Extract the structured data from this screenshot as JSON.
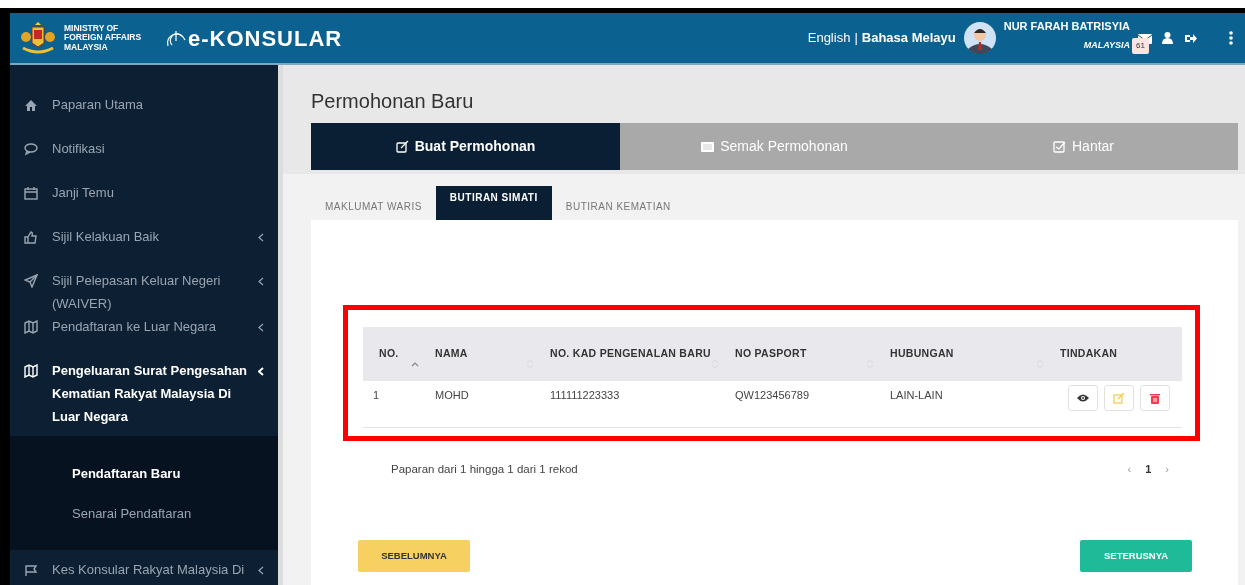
{
  "header": {
    "ministry": "MINISTRY OF FOREIGN AFFAIRS MALAYSIA",
    "app_name": "e-KONSULAR",
    "languages": [
      {
        "label": "English",
        "selected": false
      },
      {
        "label": "Bahasa Melayu",
        "selected": true
      }
    ],
    "separator": "|",
    "user_name": "NUR FARAH BATRISYIA",
    "user_country": "MALAYSIA",
    "mail_count": "61"
  },
  "sidebar": {
    "items": [
      {
        "label": "Paparan Utama",
        "has_submenu": false,
        "active": false
      },
      {
        "label": "Notifikasi",
        "has_submenu": false,
        "active": false
      },
      {
        "label": "Janji Temu",
        "has_submenu": false,
        "active": false
      },
      {
        "label": "Sijil Kelakuan Baik",
        "has_submenu": true,
        "active": false
      },
      {
        "label": "Sijil Pelepasan Keluar Negeri (WAIVER)",
        "has_submenu": true,
        "active": false
      },
      {
        "label": "Pendaftaran ke Luar Negara",
        "has_submenu": true,
        "active": false
      },
      {
        "label": "Pengeluaran Surat Pengesahan Kematian Rakyat Malaysia Di Luar Negara",
        "has_submenu": true,
        "active": true,
        "children": [
          {
            "label": "Pendaftaran Baru",
            "selected": true
          },
          {
            "label": "Senarai Pendaftaran",
            "selected": false
          }
        ]
      },
      {
        "label": "Kes Konsular Rakyat Malaysia Di",
        "has_submenu": true,
        "active": false
      }
    ]
  },
  "page_title": "Permohonan Baru",
  "steps": [
    {
      "label": "Buat Permohonan",
      "selected": true
    },
    {
      "label": "Semak Permohonan",
      "selected": false
    },
    {
      "label": "Hantar",
      "selected": false
    }
  ],
  "tabs": [
    {
      "label": "MAKLUMAT WARIS",
      "selected": false
    },
    {
      "label": "BUTIRAN SIMATI",
      "selected": true
    },
    {
      "label": "BUTIRAN KEMATIAN",
      "selected": false
    }
  ],
  "table": {
    "columns": [
      "NO.",
      "NAMA",
      "NO. KAD PENGENALAN BARU",
      "NO PASPORT",
      "HUBUNGAN",
      "TINDAKAN"
    ],
    "rows": [
      {
        "cells": [
          "1",
          "MOHD",
          "111111223333",
          "QW123456789",
          "LAIN-LAIN"
        ]
      }
    ]
  },
  "pagination": {
    "summary": "Paparan dari 1 hingga 1 dari 1 rekod",
    "prev": "‹",
    "pages": [
      {
        "label": "1",
        "selected": true
      }
    ],
    "next": "›"
  },
  "buttons": [
    {
      "label": "SEBELUMNYA",
      "kind": "previous"
    },
    {
      "label": "SETERUSNYA",
      "kind": "next"
    }
  ]
}
